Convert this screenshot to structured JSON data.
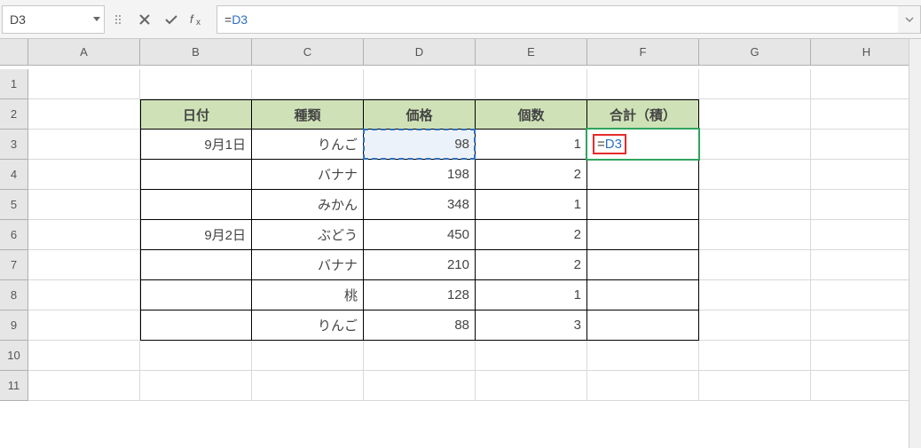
{
  "nameBox": "D3",
  "formula": {
    "prefix": "=",
    "ref": "D3"
  },
  "columns": [
    "A",
    "B",
    "C",
    "D",
    "E",
    "F",
    "G",
    "H"
  ],
  "rowCount": 11,
  "table": {
    "header": {
      "B": "日付",
      "C": "種類",
      "D": "価格",
      "E": "個数",
      "F": "合計（積）"
    },
    "rows": [
      {
        "B": "9月1日",
        "C": "りんご",
        "D": "98",
        "E": "1"
      },
      {
        "B": "",
        "C": "バナナ",
        "D": "198",
        "E": "2"
      },
      {
        "B": "",
        "C": "みかん",
        "D": "348",
        "E": "1"
      },
      {
        "B": "9月2日",
        "C": "ぶどう",
        "D": "450",
        "E": "2"
      },
      {
        "B": "",
        "C": "バナナ",
        "D": "210",
        "E": "2"
      },
      {
        "B": "",
        "C": "桃",
        "D": "128",
        "E": "1"
      },
      {
        "B": "",
        "C": "りんご",
        "D": "88",
        "E": "3"
      }
    ]
  },
  "activeCell": {
    "address": "F3",
    "display": {
      "prefix": "=",
      "ref": "D3"
    }
  },
  "refCell": {
    "address": "D3"
  }
}
